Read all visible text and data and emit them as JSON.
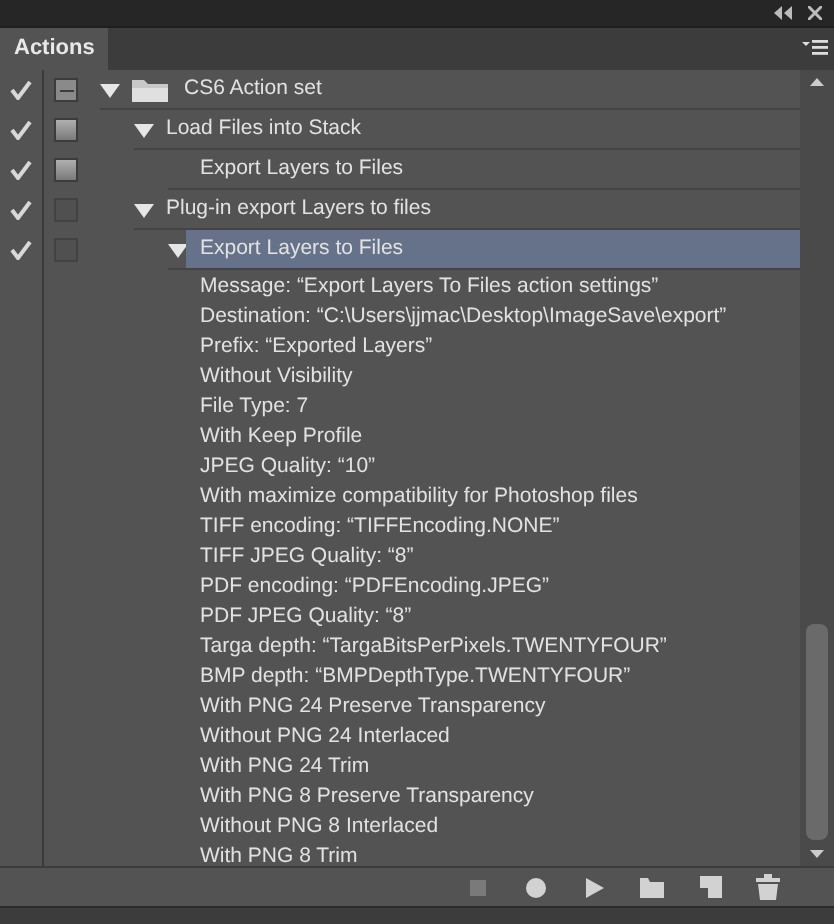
{
  "panel": {
    "tab": {
      "label": "Actions",
      "selected": true
    }
  },
  "actions": [
    {
      "kind": "set",
      "label": "CS6 Action set",
      "enabled": true,
      "dialog": true,
      "partial": true,
      "expanded": true,
      "selected": false,
      "children": [
        {
          "kind": "action",
          "label": "Load Files into Stack",
          "enabled": true,
          "dialog": true,
          "partial": false,
          "expanded": true,
          "selected": false,
          "children": [
            {
              "kind": "command",
              "label": "Export Layers to Files",
              "enabled": true,
              "dialog": true,
              "partial": false,
              "expanded": false,
              "selected": false
            }
          ]
        },
        {
          "kind": "action",
          "label": "Plug-in export Layers to files",
          "enabled": true,
          "dialog": false,
          "partial": false,
          "expanded": true,
          "selected": false,
          "children": [
            {
              "kind": "command",
              "label": "Export Layers to Files",
              "enabled": true,
              "dialog": false,
              "partial": false,
              "expanded": true,
              "selected": true,
              "parameters": [
                "Message:  “Export Layers To Files action settings”",
                "Destination:  “C:\\Users\\jjmac\\Desktop\\ImageSave\\export”",
                "Prefix:  “Exported Layers”",
                "Without Visibility",
                "File Type: 7",
                "With Keep Profile",
                "JPEG Quality:  “10”",
                "With maximize compatibility for Photoshop files",
                "TIFF encoding:  “TIFFEncoding.NONE”",
                "TIFF JPEG Quality:  “8”",
                "PDF encoding:  “PDFEncoding.JPEG”",
                "PDF JPEG Quality:  “8”",
                "Targa depth:  “TargaBitsPerPixels.TWENTYFOUR”",
                "BMP depth:  “BMPDepthType.TWENTYFOUR”",
                "With PNG 24 Preserve Transparency",
                "Without PNG 24 Interlaced",
                "With PNG 24 Trim",
                "With PNG 8 Preserve Transparency",
                "Without PNG 8 Interlaced",
                "With PNG 8 Trim"
              ]
            }
          ]
        }
      ]
    }
  ],
  "toolbar": [
    {
      "kind": "stop",
      "disabled": true
    },
    {
      "kind": "record",
      "disabled": false
    },
    {
      "kind": "play",
      "disabled": false
    },
    {
      "kind": "folder",
      "disabled": false
    },
    {
      "kind": "new",
      "disabled": false
    },
    {
      "kind": "trash",
      "disabled": false
    }
  ]
}
